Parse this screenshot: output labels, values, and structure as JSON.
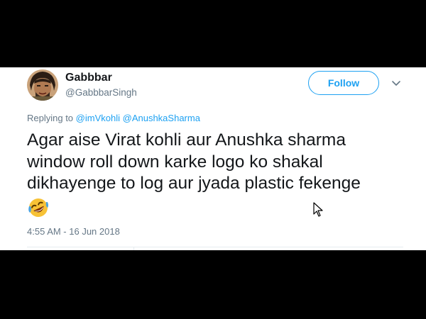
{
  "tweet": {
    "display_name": "Gabbbar",
    "handle": "@GabbbarSingh",
    "follow_label": "Follow",
    "replying_prefix": "Replying to",
    "reply_mentions": [
      "@imVkohli",
      "@AnushkaSharma"
    ],
    "text_lines": [
      "Agar aise Virat kohli aur Anushka sharma",
      "window roll down karke logo ko shakal",
      "dikhayenge to log aur jyada plastic fekenge"
    ],
    "emoji": "rolling-on-floor-laughing-emoji",
    "timestamp": "4:55 AM - 16 Jun 2018"
  },
  "colors": {
    "accent": "#1da1f2",
    "text": "#14171a",
    "muted": "#657786",
    "frame": "#000000"
  }
}
